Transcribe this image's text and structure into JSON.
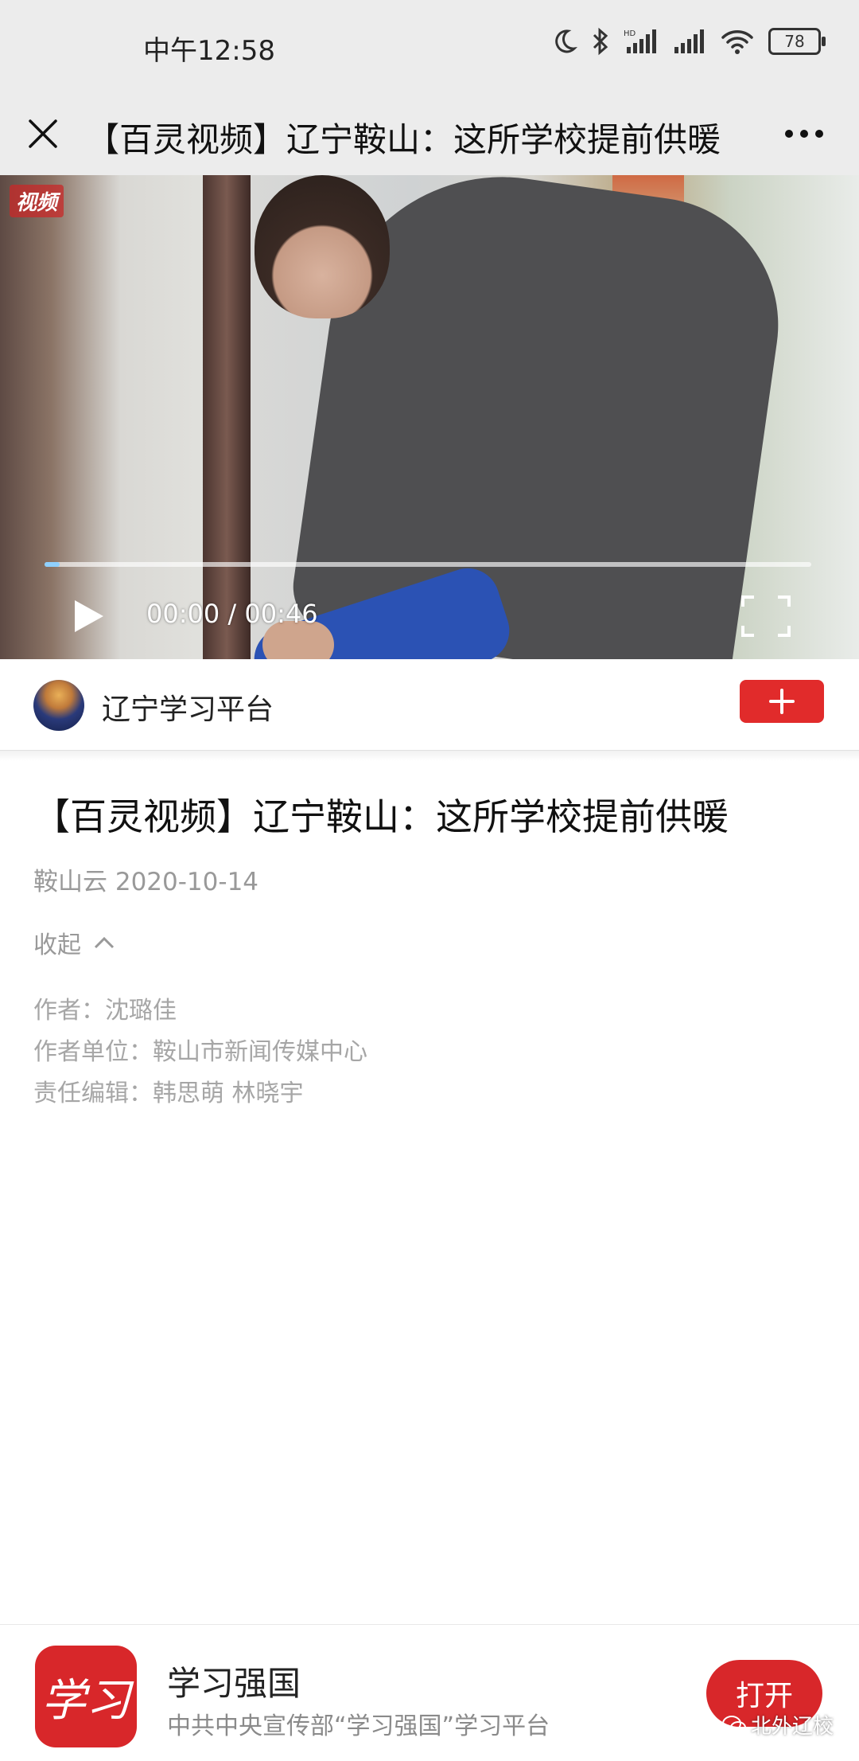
{
  "status_bar": {
    "time": "中午12:58",
    "battery": "78",
    "icons": [
      "moon-icon",
      "bluetooth-icon",
      "hd-signal-icon",
      "signal-icon",
      "wifi-icon",
      "battery-icon"
    ]
  },
  "nav": {
    "title": "【百灵视频】辽宁鞍山：这所学校提前供暖",
    "close_icon": "close-icon",
    "more_icon": "more-icon"
  },
  "video": {
    "logo_text": "视频",
    "time_display": "00:00 / 00:46",
    "progress": 0.02
  },
  "account": {
    "name": "辽宁学习平台"
  },
  "article": {
    "title": "【百灵视频】辽宁鞍山：这所学校提前供暖",
    "source": "鞍山云  2020-10-14",
    "collapse_label": "收起",
    "author": "作者：沈璐佳",
    "author_unit": "作者单位：鞍山市新闻传媒中心",
    "editors": "责任编辑：韩思萌 林晓宇"
  },
  "banner": {
    "app_name": "学习强国",
    "app_desc": "中共中央宣传部“学习强国”学习平台",
    "open_label": "打开",
    "icon_text": "学习",
    "watermark": "北外辽校"
  },
  "colors": {
    "accent_red": "#d8272a",
    "status_bg": "#ececec"
  }
}
